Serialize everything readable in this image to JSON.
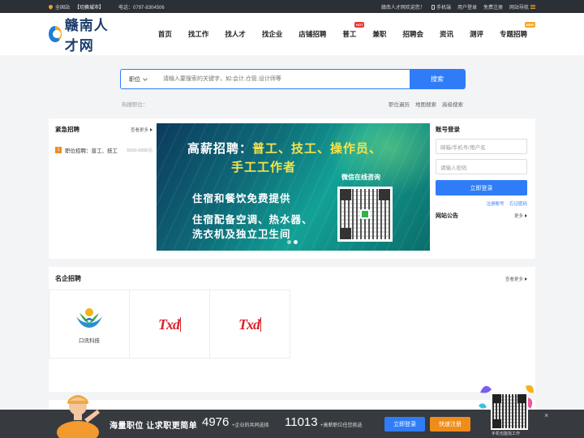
{
  "topbar": {
    "location": "全国站",
    "switch_city": "【切换城市】",
    "phone": "电话：0797-8304506",
    "welcome": "赣南人才网欢迎您！",
    "mobile": "手机端",
    "user_login": "用户登录",
    "free_register": "免费注册",
    "site_nav": "网站导航"
  },
  "header": {
    "logo_text": "赣南人才网",
    "nav": [
      {
        "label": "首页"
      },
      {
        "label": "找工作"
      },
      {
        "label": "找人才"
      },
      {
        "label": "找企业"
      },
      {
        "label": "店铺招聘"
      },
      {
        "label": "普工",
        "badge": "HOT"
      },
      {
        "label": "兼职"
      },
      {
        "label": "招聘会"
      },
      {
        "label": "资讯"
      },
      {
        "label": "测评"
      },
      {
        "label": "专题招聘",
        "badge": "NEW"
      }
    ]
  },
  "search": {
    "category": "职位",
    "placeholder": "请输入要搜索的关键字，如:会计,仓管,设计师等",
    "button": "搜索",
    "hot_label": "热搜职位：",
    "links": [
      "职位遍历",
      "地图搜索",
      "高级搜索"
    ]
  },
  "urgent": {
    "title": "紧急招聘",
    "more": "查看更多",
    "items": [
      {
        "num": "1",
        "job": "职位招聘：普工、技工",
        "salary": "5000-6000元"
      }
    ]
  },
  "banner": {
    "headline_yellow": "普工、技工、操作员、",
    "headline_white": "高薪招聘：",
    "headline2": "手工工作者",
    "wechat": "微信在线咨询",
    "line1": "住宿和餐饮免费提供",
    "line2": "住宿配备空调、热水器、",
    "line3": "洗衣机及独立卫生间"
  },
  "login": {
    "title": "账号登录",
    "username_placeholder": "邮箱/手机号/用户名",
    "password_placeholder": "请输入密码",
    "button": "立即登录",
    "register": "注册账号",
    "forgot": "忘记密码",
    "notice_title": "网站公告",
    "notice_more": "更多"
  },
  "famous": {
    "title": "名企招聘",
    "more": "查看更多",
    "companies": [
      {
        "name": "口讯科技",
        "logo": "kx-logo"
      },
      {
        "name": "",
        "logo": "Txd"
      },
      {
        "name": "",
        "logo": "Txd"
      }
    ]
  },
  "bottombar": {
    "slogan": "海量职位 让求职更简单",
    "companies_count": "4976",
    "companies_text": "+企业的共同选择",
    "jobs_count": "11013",
    "jobs_text": "+高薪职位任您挑选",
    "login": "立即登录",
    "register": "快速注册",
    "qr_caption": "手机也能找工作",
    "close": "×"
  },
  "colors": {
    "accent": "#2f7cf6",
    "orange": "#f08c1a",
    "topbar": "#2b2f36"
  }
}
